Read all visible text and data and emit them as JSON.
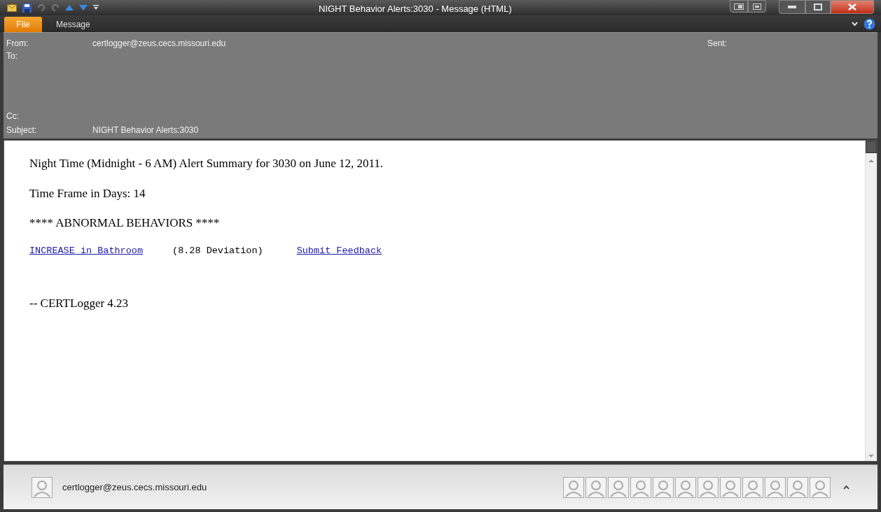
{
  "window": {
    "title": "NIGHT Behavior Alerts:3030 - Message (HTML)"
  },
  "tabs": [
    {
      "label": "File",
      "selected": true
    },
    {
      "label": "Message",
      "selected": false
    }
  ],
  "header": {
    "from_label": "From:",
    "from": "certlogger@zeus.cecs.missouri.edu",
    "to_label": "To:",
    "cc_label": "Cc:",
    "subject_label": "Subject:",
    "subject": "NIGHT Behavior Alerts:3030",
    "sent_label": "Sent:"
  },
  "body": {
    "paragraphs": [
      "Night Time (Midnight - 6 AM) Alert Summary for 3030 on June 12, 2011.",
      "Time Frame in Days: 14",
      "**** ABNORMAL BEHAVIORS ****"
    ],
    "alert_link": "INCREASE in Bathroom",
    "deviation": "(8.28 Deviation)",
    "feedback_link": "Submit Feedback",
    "signature": "-- CERTLogger 4.23"
  },
  "people_pane": {
    "sender": "certlogger@zeus.cecs.missouri.edu"
  }
}
